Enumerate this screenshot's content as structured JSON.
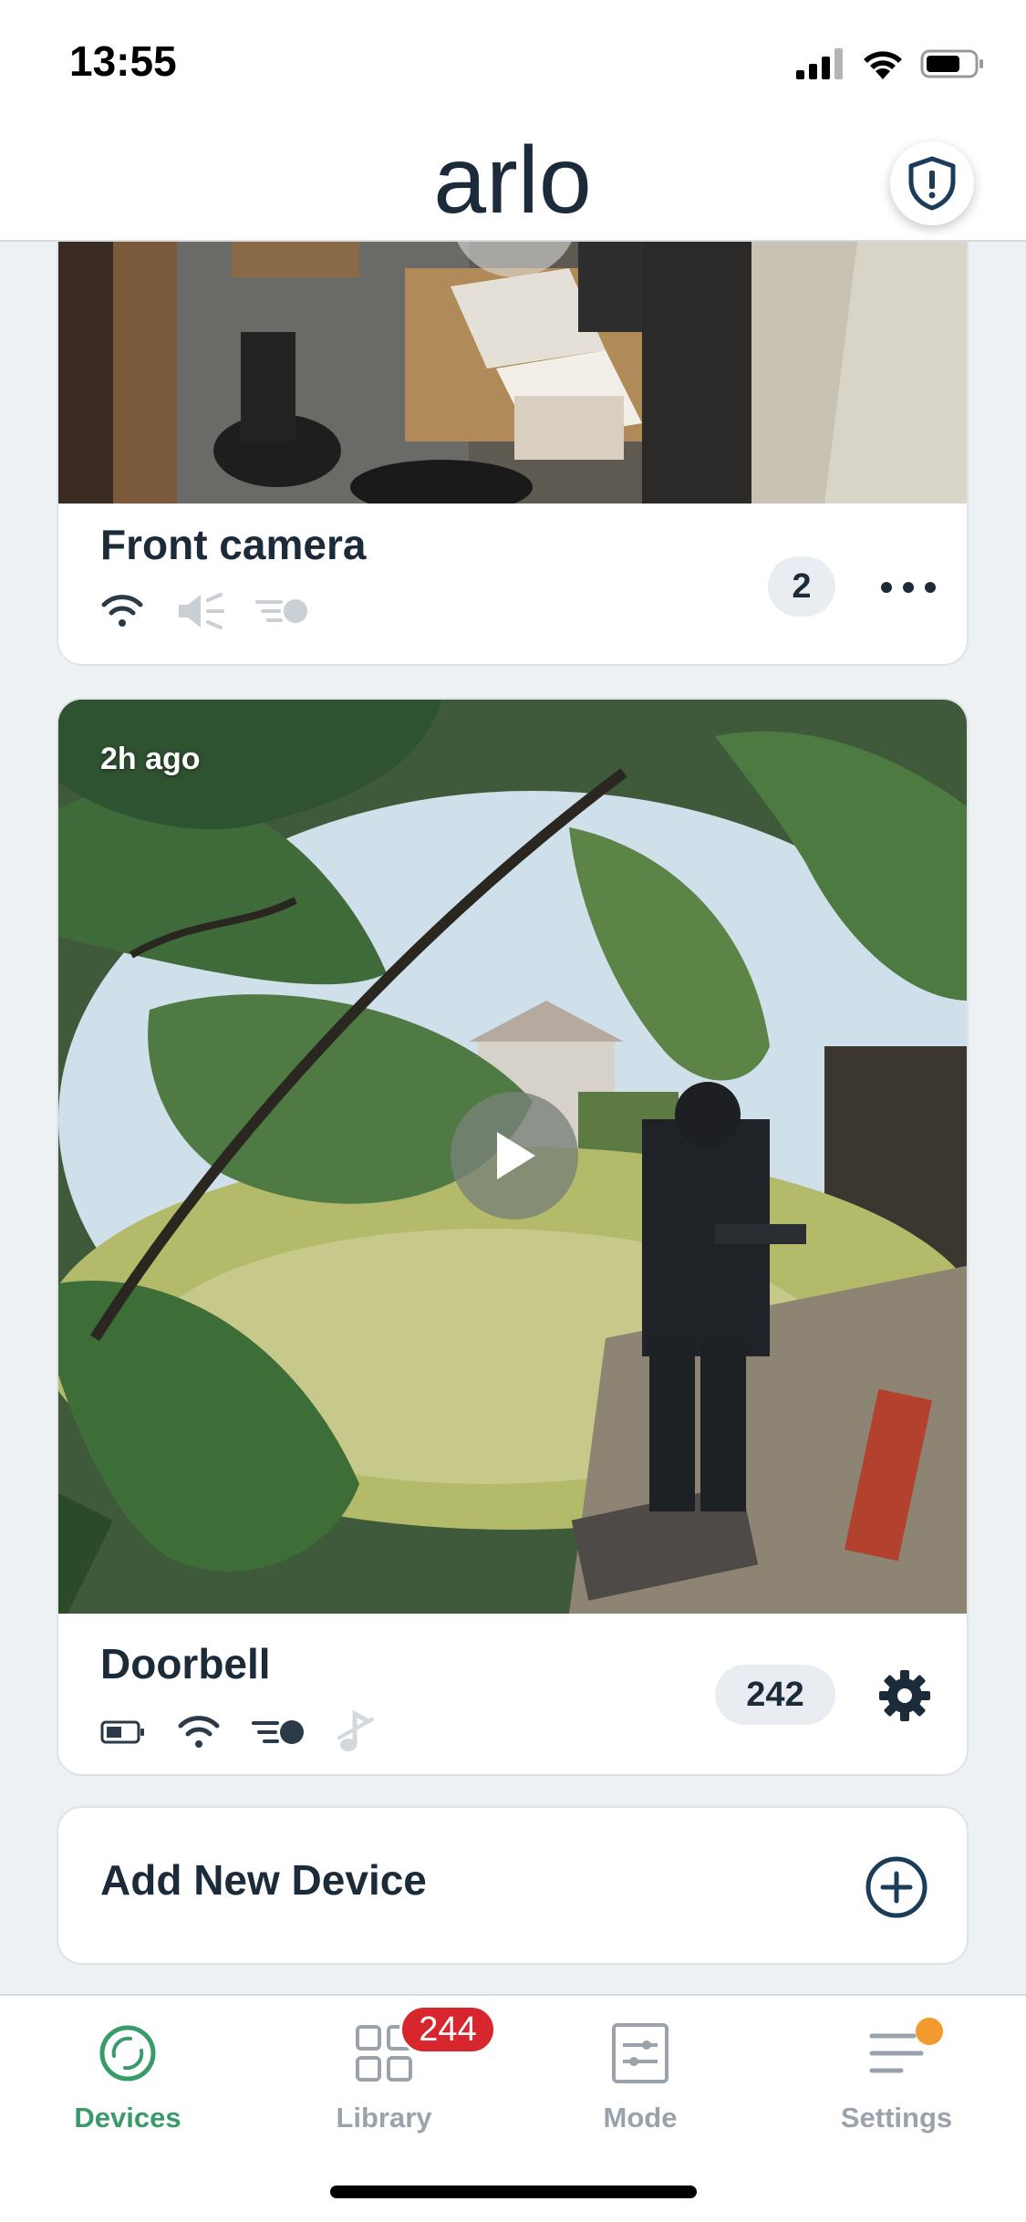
{
  "status_bar": {
    "time": "13:55"
  },
  "header": {
    "logo_text": "arlo"
  },
  "devices": [
    {
      "name": "Front camera",
      "count": "2",
      "time_ago": "",
      "icons": [
        "wifi-icon",
        "speaker-muted-icon",
        "motion-icon"
      ]
    },
    {
      "name": "Doorbell",
      "count": "242",
      "time_ago": "2h ago",
      "icons": [
        "battery-icon",
        "wifi-icon",
        "motion-icon",
        "music-off-icon"
      ]
    }
  ],
  "add_device": {
    "label": "Add New Device"
  },
  "tabs": [
    {
      "label": "Devices",
      "icon": "devices-icon",
      "active": true
    },
    {
      "label": "Library",
      "icon": "library-icon",
      "badge": "244"
    },
    {
      "label": "Mode",
      "icon": "mode-icon"
    },
    {
      "label": "Settings",
      "icon": "settings-icon",
      "notification_dot": true
    }
  ],
  "colors": {
    "brand_dark": "#1c2b39",
    "active_tab": "#3a9b6a",
    "badge_red": "#d8262e",
    "notification_orange": "#f29a2e",
    "background": "#eef1f4"
  }
}
